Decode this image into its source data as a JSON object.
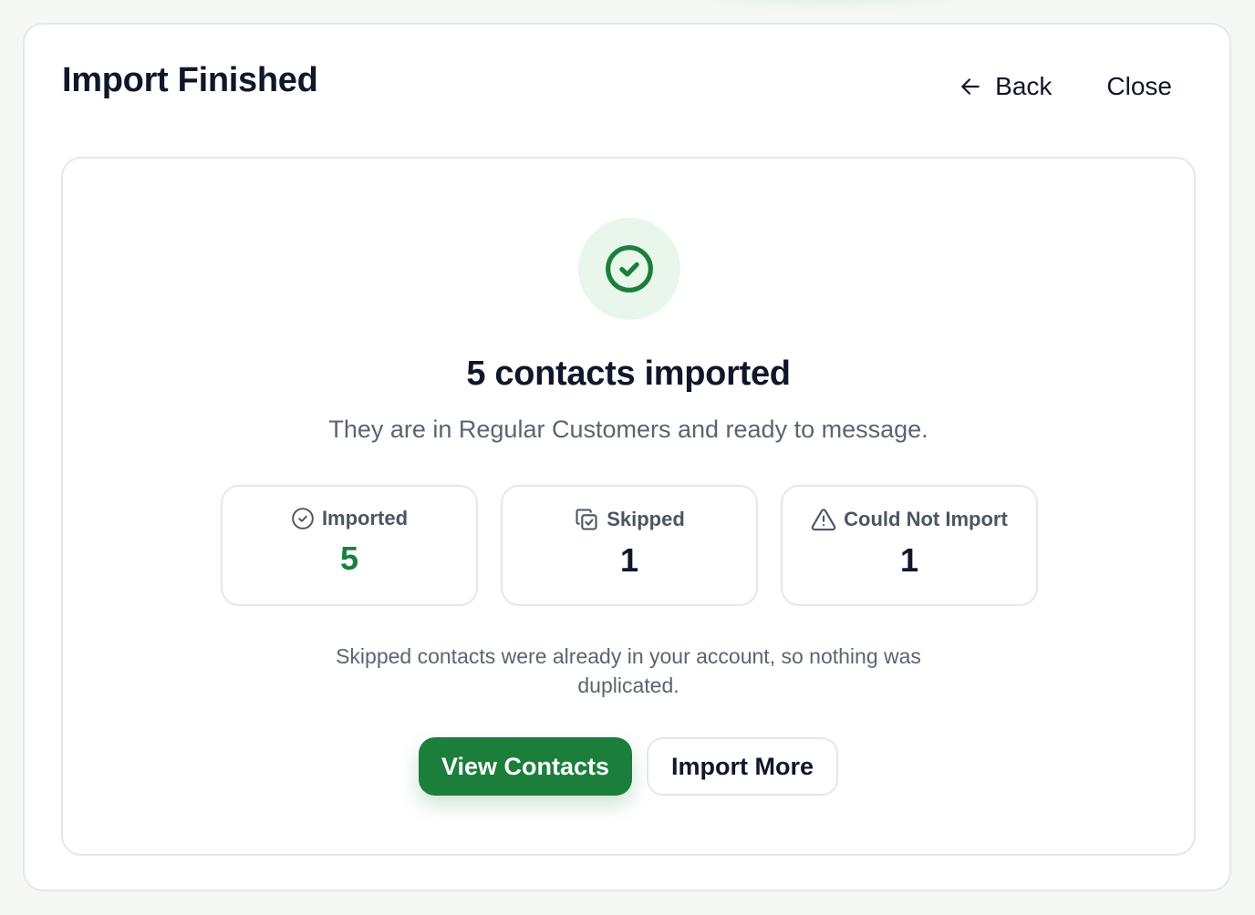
{
  "header": {
    "title": "Import Finished",
    "back_label": "Back",
    "close_label": "Close"
  },
  "result": {
    "icon": "check-circle-icon",
    "headline": "5 contacts imported",
    "subtext": "They are in Regular Customers and ready to message."
  },
  "stats": [
    {
      "icon": "check-circle-icon",
      "label": "Imported",
      "value": "5",
      "color": "#1b7f3b"
    },
    {
      "icon": "copy-check-icon",
      "label": "Skipped",
      "value": "1",
      "color": "#0f172a"
    },
    {
      "icon": "warning-triangle-icon",
      "label": "Could Not Import",
      "value": "1",
      "color": "#0f172a"
    }
  ],
  "note": "Skipped contacts were already in your account, so nothing was duplicated.",
  "actions": {
    "primary_label": "View Contacts",
    "secondary_label": "Import More"
  },
  "colors": {
    "accent": "#1b7f3b",
    "accent_soft": "#e9f6ec",
    "border": "#e5e7eb",
    "muted_text": "#5b6472"
  }
}
